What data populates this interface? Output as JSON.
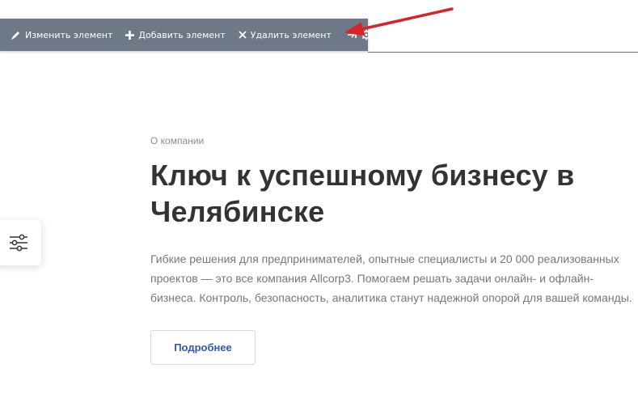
{
  "toolbar": {
    "edit_label": "Изменить элемент",
    "add_label": "Добавить элемент",
    "delete_label": "Удалить элемент",
    "icons": [
      "pencil-icon",
      "plus-icon",
      "close-icon",
      "pin-icon",
      "gear-icon"
    ]
  },
  "content": {
    "eyebrow": "О компании",
    "title": "Ключ к успешному бизнесу в Челябинске",
    "description": "Гибкие решения для предпринимателей, опытные специалисты и 20 000 реализованных проектов — это все компания Allcorp3. Помогаем решать задачи онлайн- и офлайн-бизнеса. Контроль, безопасность, аналитика станут надежной опорой для вашей команды.",
    "button_label": "Подробнее"
  },
  "colors": {
    "toolbar_bg": "#6f7886",
    "arrow": "#d9232a",
    "title": "#333333",
    "link": "#2f57b7"
  }
}
